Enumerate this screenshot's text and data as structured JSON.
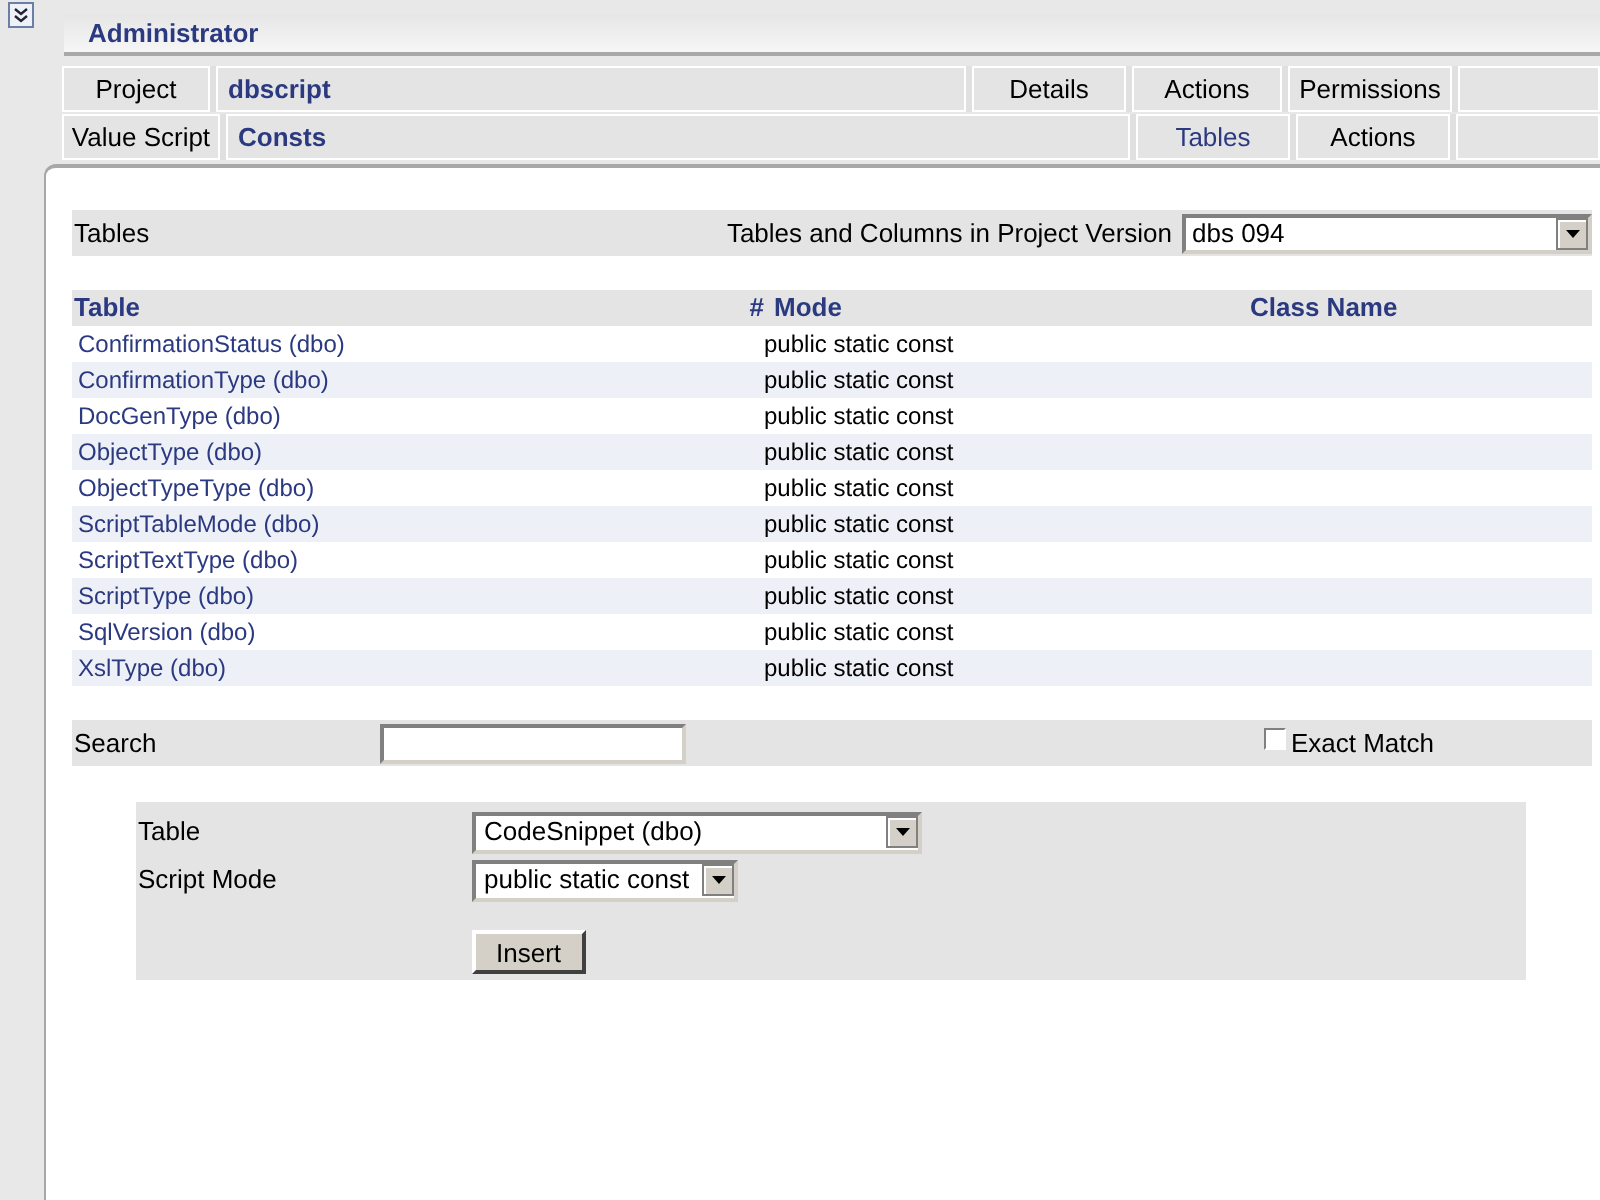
{
  "header": {
    "title": "Administrator"
  },
  "nav_row_1": {
    "label": "Project",
    "value": "dbscript",
    "tabs": [
      {
        "label": "Details",
        "selected": false
      },
      {
        "label": "Actions",
        "selected": false
      },
      {
        "label": "Permissions",
        "selected": false
      }
    ]
  },
  "nav_row_2": {
    "label": "Value Script",
    "value": "Consts",
    "tabs": [
      {
        "label": "Tables",
        "selected": true
      },
      {
        "label": "Actions",
        "selected": false
      }
    ]
  },
  "tables_bar": {
    "title": "Tables",
    "version_label": "Tables and Columns in Project Version",
    "version_value": "dbs 094"
  },
  "table": {
    "columns": [
      "Table",
      "#",
      "Mode",
      "Class Name"
    ],
    "rows": [
      {
        "table": "ConfirmationStatus (dbo)",
        "mode": "public static const"
      },
      {
        "table": "ConfirmationType (dbo)",
        "mode": "public static const"
      },
      {
        "table": "DocGenType (dbo)",
        "mode": "public static const"
      },
      {
        "table": "ObjectType (dbo)",
        "mode": "public static const"
      },
      {
        "table": "ObjectTypeType (dbo)",
        "mode": "public static const"
      },
      {
        "table": "ScriptTableMode (dbo)",
        "mode": "public static const"
      },
      {
        "table": "ScriptTextType (dbo)",
        "mode": "public static const"
      },
      {
        "table": "ScriptType (dbo)",
        "mode": "public static const"
      },
      {
        "table": "SqlVersion (dbo)",
        "mode": "public static const"
      },
      {
        "table": "XslType (dbo)",
        "mode": "public static const"
      }
    ]
  },
  "search": {
    "label": "Search",
    "exact_match": {
      "label": "Exact Match",
      "checked": false
    }
  },
  "insert_form": {
    "table_label": "Table",
    "table_value": "CodeSnippet (dbo)",
    "mode_label": "Script Mode",
    "mode_value": "public static const",
    "button": "Insert"
  }
}
